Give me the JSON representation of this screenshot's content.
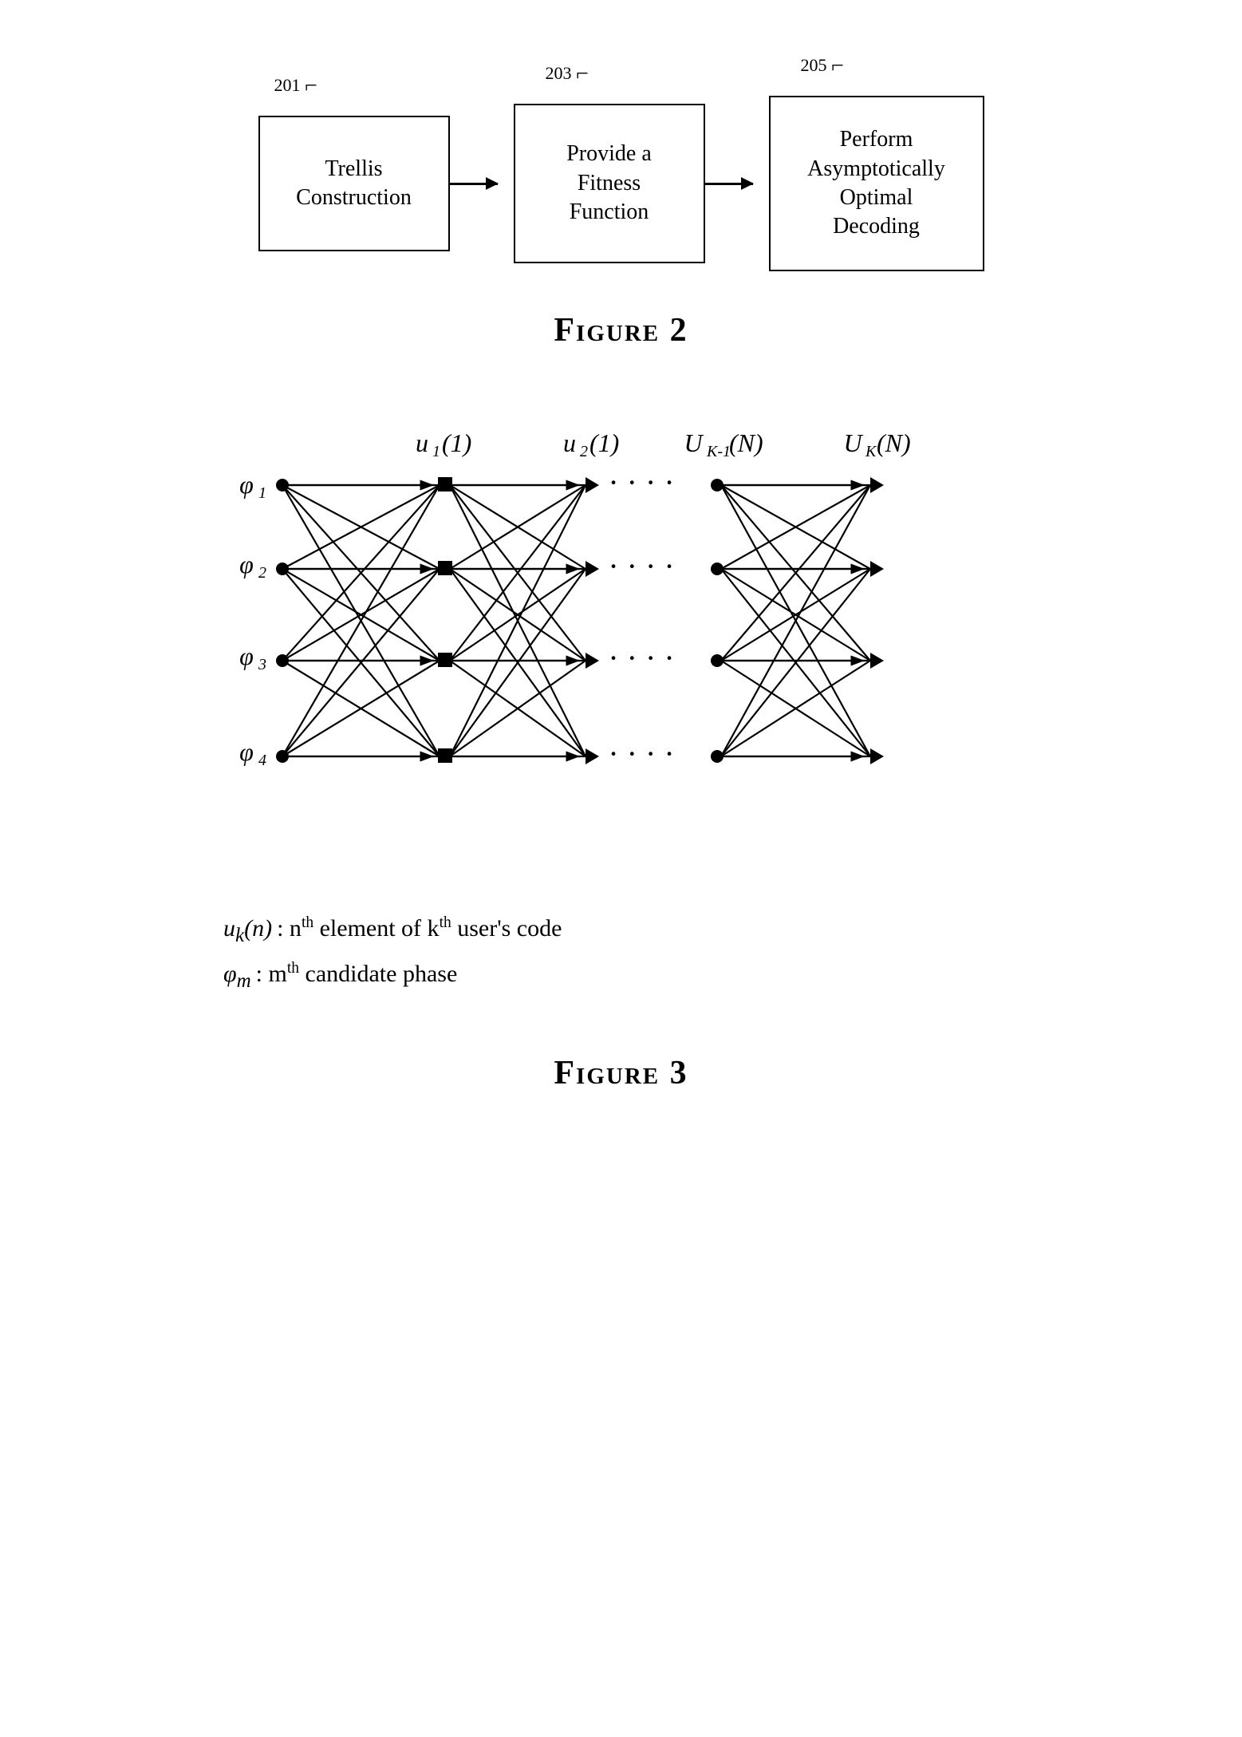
{
  "figure2": {
    "title": "Figure 2",
    "ref_201": "201",
    "ref_203": "203",
    "ref_205": "205",
    "box1_text": "Trellis\nConstruction",
    "box2_text": "Provide a\nFitness\nFunction",
    "box3_text": "Perform\nAsymptotically\nOptimal\nDecoding"
  },
  "figure3": {
    "title": "Figure 3",
    "caption_line1_italic": "u",
    "caption_line1_sub": "k",
    "caption_line1_paren": "(n)",
    "caption_line1_rest": ": n",
    "caption_line1_sup": "th",
    "caption_line1_end": " element of k",
    "caption_line1_sup2": "th",
    "caption_line1_end2": " user's code",
    "caption_line2_phi": "φ",
    "caption_line2_sub": "m",
    "caption_line2_rest": ": m",
    "caption_line2_sup": "th",
    "caption_line2_end": " candidate phase",
    "node_labels": {
      "u1_1": "u₁(1)",
      "u2_1": "u₂(1)",
      "uk1_n": "U_{K-1}(N)",
      "uk_n": "U_K(N)",
      "phi1": "φ₁",
      "phi2": "φ₂",
      "phi3": "φ₃",
      "phi4": "φ₄"
    }
  }
}
